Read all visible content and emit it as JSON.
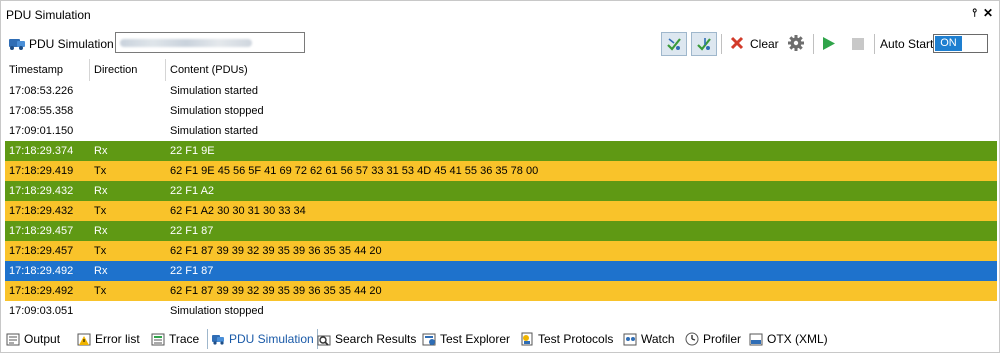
{
  "window": {
    "title": "PDU Simulation",
    "pin_glyph": "⫯",
    "close_glyph": "✕"
  },
  "toolbar": {
    "label": "PDU Simulation",
    "clear_label": "Clear",
    "autostart_label": "Auto Start",
    "autostart_state": "ON"
  },
  "table": {
    "columns": [
      "Timestamp",
      "Direction",
      "Content (PDUs)"
    ],
    "rows": [
      {
        "timestamp": "17:08:53.226",
        "direction": "",
        "content": "Simulation started",
        "kind": "info"
      },
      {
        "timestamp": "17:08:55.358",
        "direction": "",
        "content": "Simulation stopped",
        "kind": "info"
      },
      {
        "timestamp": "17:09:01.150",
        "direction": "",
        "content": "Simulation started",
        "kind": "info"
      },
      {
        "timestamp": "17:18:29.374",
        "direction": "Rx",
        "content": "22 F1 9E",
        "kind": "rx"
      },
      {
        "timestamp": "17:18:29.419",
        "direction": "Tx",
        "content": "62 F1 9E 45 56 5F 41 69 72 62 61 56 57 33 31 53 4D 45 41 55 36 35 78 00",
        "kind": "tx"
      },
      {
        "timestamp": "17:18:29.432",
        "direction": "Rx",
        "content": "22 F1 A2",
        "kind": "rx"
      },
      {
        "timestamp": "17:18:29.432",
        "direction": "Tx",
        "content": "62 F1 A2 30 30 31 30 33 34",
        "kind": "tx"
      },
      {
        "timestamp": "17:18:29.457",
        "direction": "Rx",
        "content": "22 F1 87",
        "kind": "rx"
      },
      {
        "timestamp": "17:18:29.457",
        "direction": "Tx",
        "content": "62 F1 87 39 39 32 39 35 39 36 35 35 44 20",
        "kind": "tx"
      },
      {
        "timestamp": "17:18:29.492",
        "direction": "Rx",
        "content": "22 F1 87",
        "kind": "selected"
      },
      {
        "timestamp": "17:18:29.492",
        "direction": "Tx",
        "content": "62 F1 87 39 39 32 39 35 39 36 35 35 44 20",
        "kind": "tx"
      },
      {
        "timestamp": "17:09:03.051",
        "direction": "",
        "content": "Simulation stopped",
        "kind": "info"
      }
    ]
  },
  "colors": {
    "rx": "#5f9914",
    "tx": "#f9c32a",
    "selected": "#1e72cc",
    "info": "#ffffff",
    "accent": "#1a5aa8"
  },
  "bottom_tabs": [
    {
      "label": "Output",
      "icon": "output-icon"
    },
    {
      "label": "Error list",
      "icon": "error-list-icon"
    },
    {
      "label": "Trace",
      "icon": "trace-icon"
    },
    {
      "label": "PDU Simulation",
      "icon": "pdu-simulation-icon",
      "active": true
    },
    {
      "label": "Search Results",
      "icon": "search-results-icon"
    },
    {
      "label": "Test Explorer",
      "icon": "test-explorer-icon"
    },
    {
      "label": "Test Protocols",
      "icon": "test-protocols-icon"
    },
    {
      "label": "Watch",
      "icon": "watch-icon"
    },
    {
      "label": "Profiler",
      "icon": "profiler-icon"
    },
    {
      "label": "OTX (XML)",
      "icon": "otx-xml-icon"
    }
  ]
}
